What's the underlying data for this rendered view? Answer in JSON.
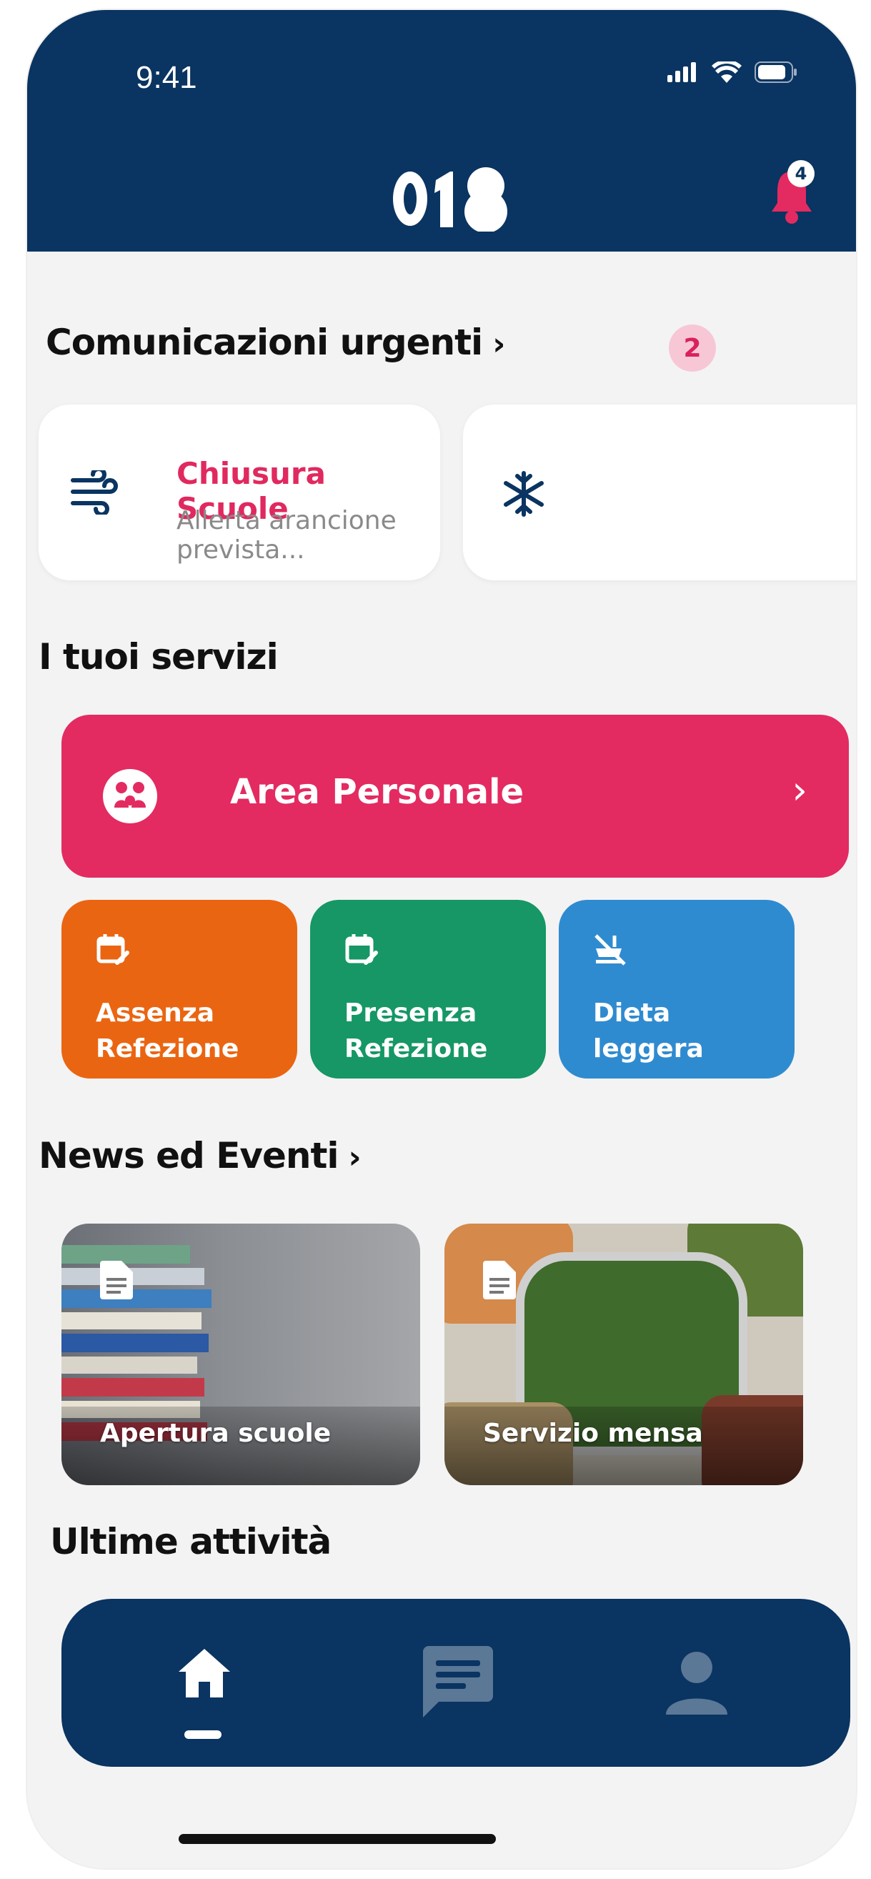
{
  "status": {
    "time": "9:41"
  },
  "header": {
    "logo_text": "018",
    "notification_count": "4"
  },
  "urgent": {
    "title": "Comunicazioni urgenti",
    "count": "2",
    "items": [
      {
        "title": "Chiusura Scuole",
        "subtitle": "Allerta arancione prevista...",
        "icon": "wind-icon"
      },
      {
        "title": "",
        "subtitle": "",
        "icon": "snowflake-icon"
      }
    ]
  },
  "services": {
    "title": "I tuoi servizi",
    "area_personale": "Area Personale",
    "tiles": [
      {
        "label": "Assenza\nRefezione",
        "color": "#ea6511",
        "icon": "calendar-edit-icon"
      },
      {
        "label": "Presenza\nRefezione",
        "color": "#169765",
        "icon": "calendar-edit-icon"
      },
      {
        "label": "Dieta\nleggera",
        "color": "#2f8bd0",
        "icon": "no-food-icon"
      }
    ]
  },
  "news": {
    "title": "News ed Eventi",
    "items": [
      {
        "label": "Apertura scuole",
        "icon": "document-icon"
      },
      {
        "label": "Servizio mensa",
        "icon": "document-icon"
      }
    ]
  },
  "activities": {
    "title": "Ultime attività"
  },
  "nav": {
    "items": [
      {
        "icon": "home-icon",
        "active": true
      },
      {
        "icon": "chat-icon",
        "active": false
      },
      {
        "icon": "profile-icon",
        "active": false
      }
    ]
  },
  "colors": {
    "primary": "#0a3461",
    "accent": "#e32b61"
  }
}
